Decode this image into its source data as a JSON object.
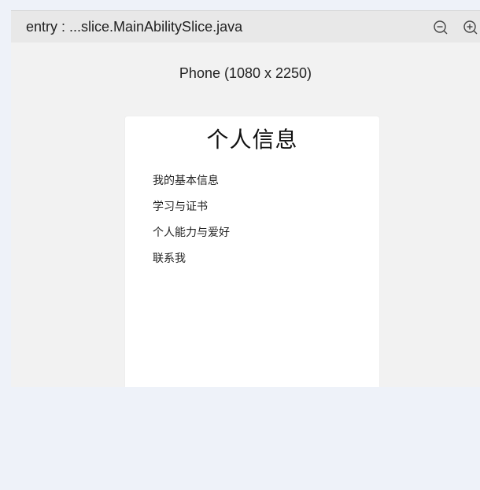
{
  "window": {
    "file_title": "entry : ...slice.MainAbilitySlice.java"
  },
  "toolbar": {
    "zoom_out_icon": "zoom-out-icon",
    "zoom_in_icon": "zoom-in-icon"
  },
  "preview": {
    "device_label": "Phone (1080 x 2250)"
  },
  "app": {
    "title": "个人信息",
    "menu": [
      {
        "label": "我的基本信息"
      },
      {
        "label": "学习与证书"
      },
      {
        "label": "个人能力与爱好"
      },
      {
        "label": "联系我"
      }
    ]
  },
  "colors": {
    "page_background": "#eef2f9",
    "panel_background": "#f2f2f2",
    "titlebar_background": "#e8e8e8",
    "phone_screen": "#ffffff"
  }
}
